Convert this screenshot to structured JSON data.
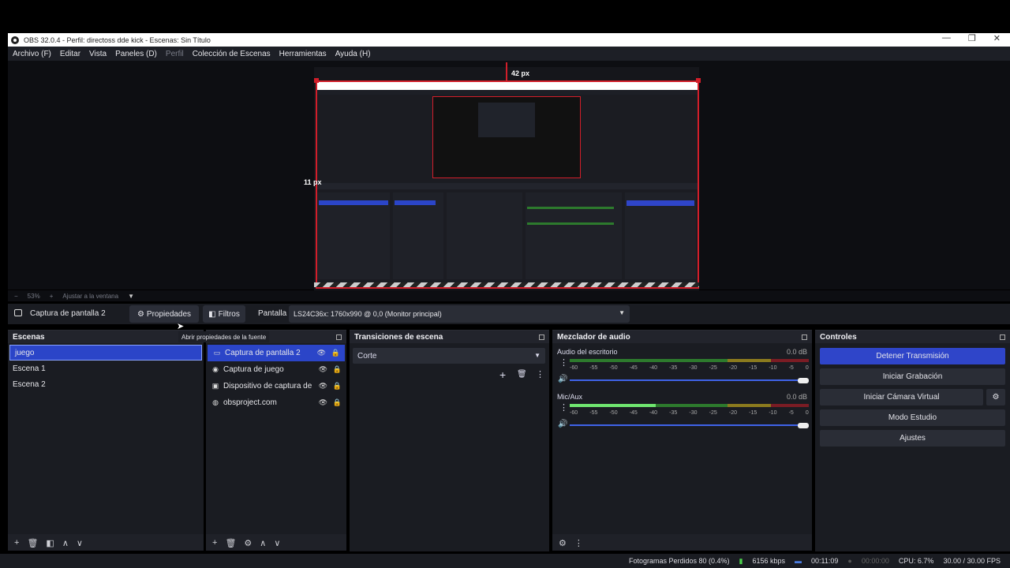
{
  "window": {
    "title": "OBS 32.0.4 - Perfil: directoss dde kick - Escenas: Sin Título",
    "minimize": "—",
    "maximize": "❐",
    "close": "✕"
  },
  "menu": {
    "items": [
      "Archivo (F)",
      "Editar",
      "Vista",
      "Paneles (D)",
      "Perfil",
      "Colección de Escenas",
      "Herramientas",
      "Ayuda (H)"
    ]
  },
  "preview": {
    "top_offset_label": "42 px",
    "left_offset_label": "11 px"
  },
  "zoom": {
    "minus": "−",
    "percent": "53%",
    "plus": "+",
    "fit_label": "Ajustar a la ventana"
  },
  "source_bar": {
    "source_name": "Captura de pantalla 2",
    "properties_label": "Propiedades",
    "filters_label": "Filtros",
    "display_label": "Pantalla",
    "display_value": "LS24C36x: 1760x990 @ 0,0 (Monitor principal)"
  },
  "tooltip": "Abrir propiedades de la fuente",
  "scenes": {
    "title": "Escenas",
    "items": [
      "juego",
      "Escena 1",
      "Escena 2"
    ]
  },
  "sources": {
    "items": [
      "Captura de pantalla 2",
      "Captura de juego",
      "Dispositivo de captura de",
      "obsproject.com"
    ]
  },
  "transitions": {
    "title": "Transiciones de escena",
    "selected": "Corte"
  },
  "mixer": {
    "title": "Mezclador de audio",
    "channels": [
      {
        "name": "Audio del escritorio",
        "db": "0.0 dB",
        "level": 0
      },
      {
        "name": "Mic/Aux",
        "db": "0.0 dB",
        "level": 0.36
      }
    ],
    "ticks": [
      "-60",
      "-55",
      "-50",
      "-45",
      "-40",
      "-35",
      "-30",
      "-25",
      "-20",
      "-15",
      "-10",
      "-5",
      "0"
    ]
  },
  "controls": {
    "title": "Controles",
    "buttons": [
      "Detener Transmisión",
      "Iniciar Grabación",
      "Iniciar Cámara Virtual",
      "Modo Estudio",
      "Ajustes"
    ]
  },
  "status": {
    "dropped_frames": "Fotogramas Perdidos 80 (0.4%)",
    "bitrate": "6156 kbps",
    "stream_time": "00:11:09",
    "record_time": "00:00:00",
    "cpu": "CPU: 6.7%",
    "fps": "30.00 / 30.00 FPS"
  },
  "colors": {
    "accent": "#2b45c8",
    "selection_outline": "#d21e2a"
  }
}
